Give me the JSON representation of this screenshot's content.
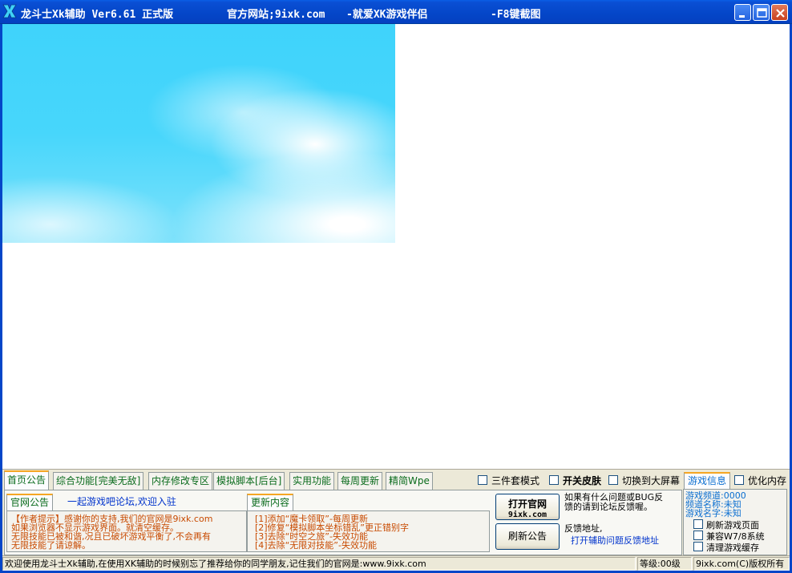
{
  "window": {
    "title": "龙斗士Xk辅助 Ver6.61 正式版",
    "site_label": "官方网站;9ixk.com",
    "slogan": "-就爱XK游戏伴侣",
    "screenshot_hint": "-F8键截图"
  },
  "tabs": [
    {
      "label": "首页公告",
      "active": true
    },
    {
      "label": "综合功能[完美无敌]",
      "active": false
    },
    {
      "label": "内存修改专区",
      "active": false
    },
    {
      "label": "模拟脚本[后台]",
      "active": false
    },
    {
      "label": "实用功能",
      "active": false
    },
    {
      "label": "每周更新",
      "active": false
    },
    {
      "label": "精简Wpe",
      "active": false
    }
  ],
  "home": {
    "notice_tab": "官网公告",
    "forum_link": "一起游戏吧论坛,欢迎入驻",
    "notice_lines": [
      "【作者提示】感谢你的支持,我们的官网是9ixk.com",
      "如果浏览器不显示游戏界面。就清空缓存。",
      "无限技能已被和谐,况且已破坏游戏平衡了,不会再有",
      "无限技能了请谅解。"
    ],
    "update_tab": "更新内容",
    "update_lines": [
      "[1]添加“魔卡领取”-每周更新",
      "[2]修复“模拟脚本坐标错乱”更正错别字",
      "[3]去除“时空之旅”-失效功能",
      "[4]去除“无限对技能”-失效功能"
    ],
    "open_site_button": {
      "line1": "打开官网",
      "line2": "9ixk.com"
    },
    "refresh_notice_button": "刷新公告",
    "feedback_text_1": "如果有什么问题或BUG反",
    "feedback_text_2": "馈的请到论坛反馈喔。",
    "feedback_addr_label": "反馈地址,",
    "feedback_link": "打开辅助问题反馈地址"
  },
  "options": {
    "three_piece": "三件套模式",
    "skin_toggle": "开关皮肤",
    "fullscreen": "切换到大屏幕",
    "optimize_memory": "优化内存"
  },
  "game_info": {
    "tab": "游戏信息",
    "channel": "游戏频道:0000",
    "channel_name": "频道名称:未知",
    "game_name": "游戏名字:未知",
    "refresh_page": "刷新游戏页面",
    "compat_win7": "兼容W7/8系统",
    "clear_cache": "清理游戏缓存"
  },
  "statusbar": {
    "message": "欢迎使用龙斗士Xk辅助,在使用XK辅助的时候别忘了推荐给你的同学朋友,记住我们的官网是:www.9ixk.com",
    "level": "等级:00级",
    "copyright": "9ixk.com(C)版权所有"
  }
}
